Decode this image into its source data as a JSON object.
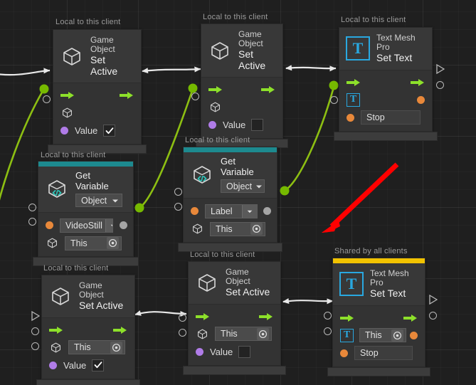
{
  "app": {
    "title": "Visual Scripting Graph Editor",
    "background_color": "#1f1f1f",
    "wire_flow_color": "#e8e8e8",
    "wire_data_color": "#76b900",
    "annotation_color": "#ff0000"
  },
  "scope_labels": {
    "local": "Local to this client",
    "shared": "Shared by all clients"
  },
  "accent_colors": {
    "get_variable": "#1d8a8f",
    "shared_node": "#f2c300"
  },
  "port_colors": {
    "flow": "#8de02a",
    "object": "#b07ce8",
    "string": "#e8883a",
    "generic": "#a5a5a5",
    "connected": "#76b900"
  },
  "icons": {
    "game_object": "cube-icon",
    "get_variable": "cube-code-icon",
    "text_mesh_pro": "tmp-t-icon",
    "flow_arrow": "flow-arrow-icon",
    "dropdown_caret": "chevron-down-icon",
    "target_picker": "target-picker-icon",
    "checkmark": "check-icon"
  },
  "nodes": [
    {
      "id": "set-active-1",
      "scope": "Local to this client",
      "title_top": "Game Object",
      "title_bottom": "Set Active",
      "icon": "cube-icon",
      "accent": null,
      "rows": [
        {
          "kind": "flow",
          "in_label": "",
          "out_label": ""
        },
        {
          "kind": "object-target",
          "icon": "cube-icon",
          "value": "",
          "has_field": false
        },
        {
          "kind": "value-check",
          "label": "Value",
          "checked": true
        }
      ]
    },
    {
      "id": "set-active-2",
      "scope": "Local to this client",
      "title_top": "Game Object",
      "title_bottom": "Set Active",
      "icon": "cube-icon",
      "accent": null,
      "rows": [
        {
          "kind": "flow"
        },
        {
          "kind": "object-target",
          "icon": "cube-icon",
          "value": "",
          "has_field": false
        },
        {
          "kind": "value-check",
          "label": "Value",
          "checked": false
        }
      ]
    },
    {
      "id": "set-text-1",
      "scope": "Local to this client",
      "title_top": "Text Mesh Pro",
      "title_bottom": "Set Text",
      "icon": "tmp-t-icon",
      "accent": null,
      "rows": [
        {
          "kind": "flow"
        },
        {
          "kind": "tmp-target",
          "value": ""
        },
        {
          "kind": "text-field",
          "value": "Stop"
        }
      ]
    },
    {
      "id": "get-variable-1",
      "scope": "Local to this client",
      "title_top": "Get Variable",
      "title_bottom": "",
      "icon": "cube-code-icon",
      "accent": "#1d8a8f",
      "type_dropdown": "Object",
      "rows": [
        {
          "kind": "var-dropdown",
          "value": "VideoStill"
        },
        {
          "kind": "object-field",
          "value": "This"
        }
      ]
    },
    {
      "id": "get-variable-2",
      "scope": "Local to this client",
      "title_top": "Get Variable",
      "title_bottom": "",
      "icon": "cube-code-icon",
      "accent": "#1d8a8f",
      "type_dropdown": "Object",
      "rows": [
        {
          "kind": "var-dropdown",
          "value": "Label"
        },
        {
          "kind": "object-field",
          "value": "This"
        }
      ]
    },
    {
      "id": "set-active-3",
      "scope": "Local to this client",
      "title_top": "Game Object",
      "title_bottom": "Set Active",
      "icon": "cube-icon",
      "accent": null,
      "rows": [
        {
          "kind": "flow"
        },
        {
          "kind": "object-field",
          "value": "This"
        },
        {
          "kind": "value-check",
          "label": "Value",
          "checked": true
        }
      ]
    },
    {
      "id": "set-active-4",
      "scope": "Local to this client",
      "title_top": "Game Object",
      "title_bottom": "Set Active",
      "icon": "cube-icon",
      "accent": null,
      "rows": [
        {
          "kind": "flow"
        },
        {
          "kind": "object-field",
          "value": "This"
        },
        {
          "kind": "value-check",
          "label": "Value",
          "checked": false
        }
      ]
    },
    {
      "id": "set-text-2",
      "scope": "Shared by all clients",
      "title_top": "Text Mesh Pro",
      "title_bottom": "Set Text",
      "icon": "tmp-t-icon",
      "accent": "#f2c300",
      "rows": [
        {
          "kind": "flow"
        },
        {
          "kind": "tmp-target",
          "value": "This"
        },
        {
          "kind": "text-field",
          "value": "Stop"
        }
      ]
    }
  ],
  "labels": {
    "value": "Value",
    "this": "This",
    "stop": "Stop",
    "object_type": "Object",
    "video_still": "VideoStill",
    "label_var": "Label",
    "game_object": "Game Object",
    "set_active": "Set Active",
    "text_mesh_pro": "Text Mesh Pro",
    "set_text": "Set Text",
    "get_variable": "Get Variable",
    "tmp_glyph": "T"
  },
  "annotation": {
    "type": "red-arrow",
    "direction": "down-left",
    "color": "#ff0000"
  }
}
